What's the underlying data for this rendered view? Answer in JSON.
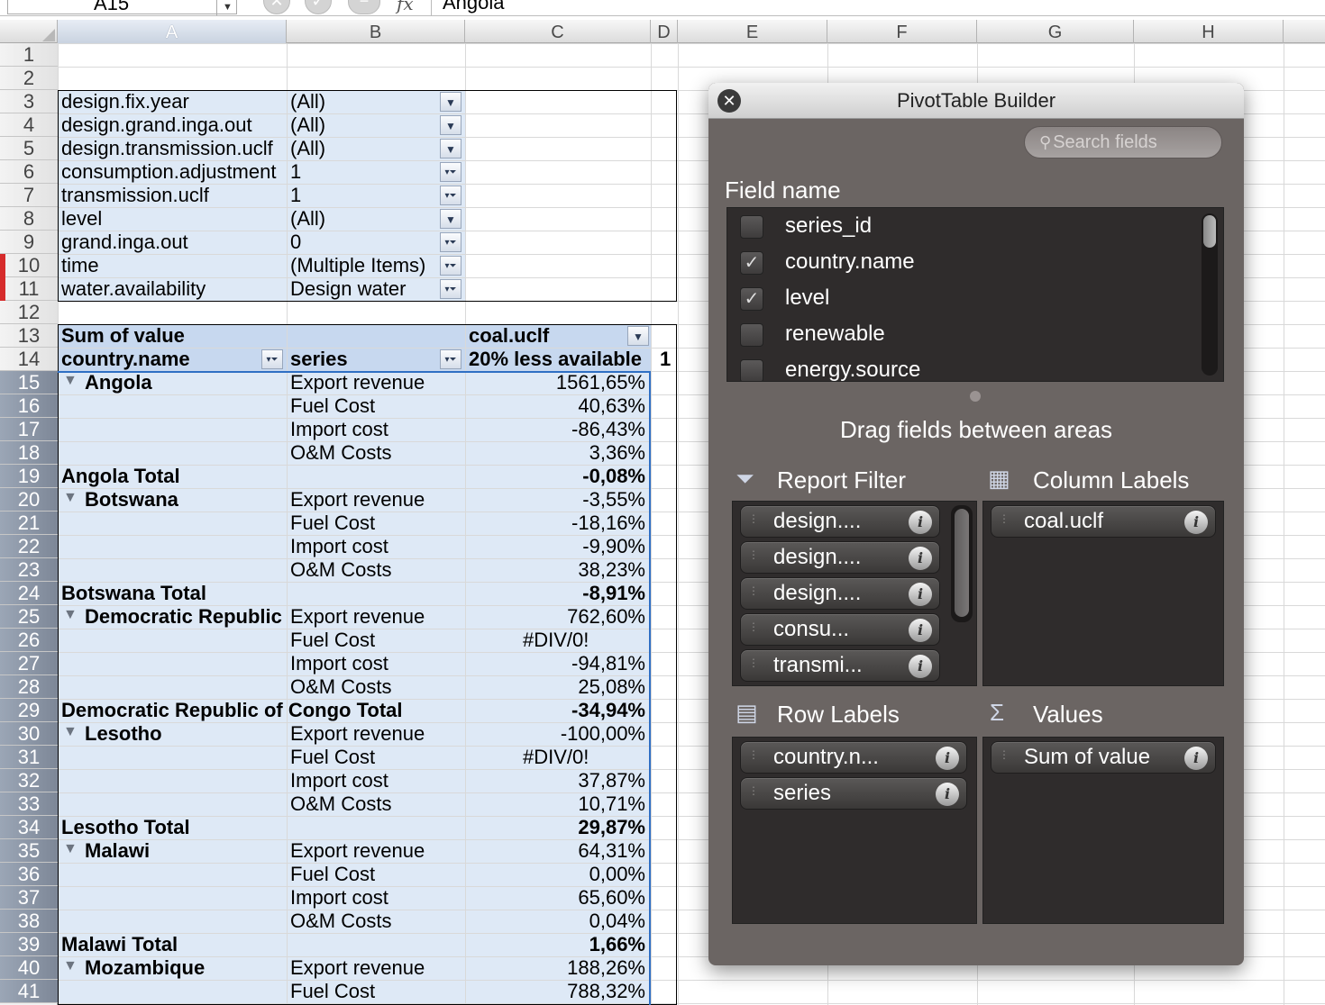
{
  "formula_bar": {
    "name_box": "A15",
    "formula": "Angola",
    "fx": "fx",
    "cancel_icon": "x-circle-icon",
    "confirm_icon": "check-circle-icon"
  },
  "columns": [
    "A",
    "B",
    "C",
    "D",
    "E",
    "F",
    "G",
    "H"
  ],
  "selected_column": "A",
  "rows": [
    {
      "num": "1",
      "a": "",
      "b": "",
      "c": ""
    },
    {
      "num": "2",
      "a": "",
      "b": "",
      "c": ""
    },
    {
      "num": "3",
      "a": "design.fix.year",
      "b": "(All)",
      "c": ""
    },
    {
      "num": "4",
      "a": "design.grand.inga.out",
      "b": "(All)",
      "c": ""
    },
    {
      "num": "5",
      "a": "design.transmission.uclf",
      "b": "(All)",
      "c": ""
    },
    {
      "num": "6",
      "a": "consumption.adjustment",
      "b": "1",
      "c": ""
    },
    {
      "num": "7",
      "a": "transmission.uclf",
      "b": "1",
      "c": ""
    },
    {
      "num": "8",
      "a": "level",
      "b": "(All)",
      "c": ""
    },
    {
      "num": "9",
      "a": "grand.inga.out",
      "b": "0",
      "c": ""
    },
    {
      "num": "10",
      "a": "time",
      "b": "(Multiple Items)",
      "c": ""
    },
    {
      "num": "11",
      "a": "water.availability",
      "b": "Design water",
      "c": ""
    },
    {
      "num": "12",
      "a": "",
      "b": "",
      "c": ""
    },
    {
      "num": "13",
      "a": "Sum of value",
      "b": "",
      "c": "coal.uclf"
    },
    {
      "num": "14",
      "a": "country.name",
      "b": "series",
      "c": "20% less available",
      "d": "1"
    },
    {
      "num": "15",
      "a": "Angola",
      "b": "Export revenue",
      "c": "1561,65%"
    },
    {
      "num": "16",
      "a": "",
      "b": "Fuel Cost",
      "c": "40,63%"
    },
    {
      "num": "17",
      "a": "",
      "b": "Import cost",
      "c": "-86,43%"
    },
    {
      "num": "18",
      "a": "",
      "b": "O&M Costs",
      "c": "3,36%"
    },
    {
      "num": "19",
      "a": "Angola Total",
      "b": "",
      "c": "-0,08%"
    },
    {
      "num": "20",
      "a": "Botswana",
      "b": "Export revenue",
      "c": "-3,55%"
    },
    {
      "num": "21",
      "a": "",
      "b": "Fuel Cost",
      "c": "-18,16%"
    },
    {
      "num": "22",
      "a": "",
      "b": "Import cost",
      "c": "-9,90%"
    },
    {
      "num": "23",
      "a": "",
      "b": "O&M Costs",
      "c": "38,23%"
    },
    {
      "num": "24",
      "a": "Botswana Total",
      "b": "",
      "c": "-8,91%"
    },
    {
      "num": "25",
      "a": "Democratic Republic",
      "b": "Export revenue",
      "c": "762,60%"
    },
    {
      "num": "26",
      "a": "",
      "b": "Fuel Cost",
      "c": "#DIV/0!"
    },
    {
      "num": "27",
      "a": "",
      "b": "Import cost",
      "c": "-94,81%"
    },
    {
      "num": "28",
      "a": "",
      "b": "O&M Costs",
      "c": "25,08%"
    },
    {
      "num": "29",
      "a": "Democratic Republic of Congo Total",
      "b": "",
      "c": "-34,94%"
    },
    {
      "num": "30",
      "a": "Lesotho",
      "b": "Export revenue",
      "c": "-100,00%"
    },
    {
      "num": "31",
      "a": "",
      "b": "Fuel Cost",
      "c": "#DIV/0!"
    },
    {
      "num": "32",
      "a": "",
      "b": "Import cost",
      "c": "37,87%"
    },
    {
      "num": "33",
      "a": "",
      "b": "O&M Costs",
      "c": "10,71%"
    },
    {
      "num": "34",
      "a": "Lesotho Total",
      "b": "",
      "c": "29,87%"
    },
    {
      "num": "35",
      "a": "Malawi",
      "b": "Export revenue",
      "c": "64,31%"
    },
    {
      "num": "36",
      "a": "",
      "b": "Fuel Cost",
      "c": "0,00%"
    },
    {
      "num": "37",
      "a": "",
      "b": "Import cost",
      "c": "65,60%"
    },
    {
      "num": "38",
      "a": "",
      "b": "O&M Costs",
      "c": "0,04%"
    },
    {
      "num": "39",
      "a": "Malawi Total",
      "b": "",
      "c": "1,66%"
    },
    {
      "num": "40",
      "a": "Mozambique",
      "b": "Export revenue",
      "c": "188,26%"
    },
    {
      "num": "41",
      "a": "",
      "b": "Fuel Cost",
      "c": "788,32%"
    }
  ],
  "pivot_builder": {
    "title": "PivotTable Builder",
    "search_placeholder": "Search fields",
    "field_name_label": "Field name",
    "fields": [
      {
        "label": "series_id",
        "checked": false
      },
      {
        "label": "country.name",
        "checked": true
      },
      {
        "label": "level",
        "checked": true
      },
      {
        "label": "renewable",
        "checked": false
      },
      {
        "label": "energy.source",
        "checked": false
      }
    ],
    "drag_label": "Drag fields between areas",
    "report_filter": {
      "label": "Report Filter",
      "items": [
        "design....",
        "design....",
        "design....",
        "consu...",
        "transmi..."
      ]
    },
    "column_labels": {
      "label": "Column Labels",
      "items": [
        "coal.uclf"
      ]
    },
    "row_labels": {
      "label": "Row Labels",
      "items": [
        "country.n...",
        "series"
      ]
    },
    "values": {
      "label": "Values",
      "items": [
        "Sum of value"
      ]
    }
  },
  "colors": {
    "pivot_shade": "#dee9f6",
    "selection_border": "#2f6fc4",
    "panel_bg": "#6b6563"
  }
}
